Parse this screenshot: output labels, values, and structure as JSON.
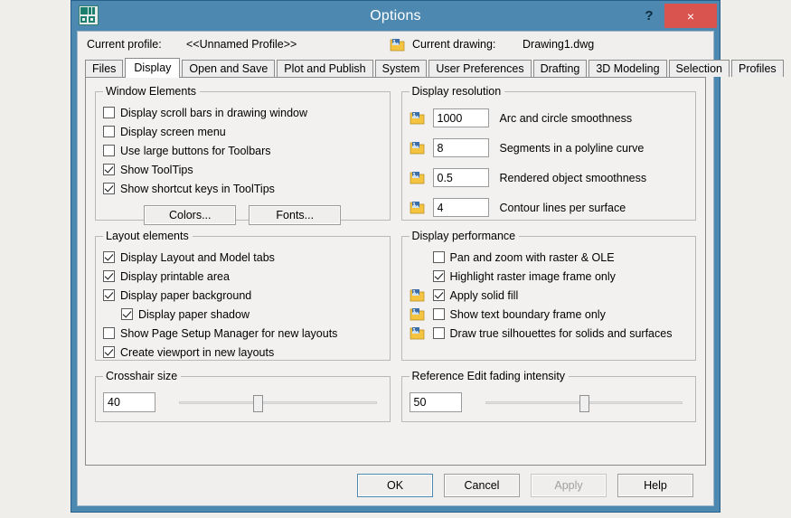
{
  "window": {
    "title": "Options",
    "app_icon": "autocad-icon",
    "help_button": "?",
    "close_button": "×"
  },
  "profile_row": {
    "current_profile_label": "Current profile:",
    "current_profile_value": "<<Unnamed Profile>>",
    "current_drawing_label": "Current drawing:",
    "current_drawing_value": "Drawing1.dwg",
    "drawing_icon": "drawing-file-icon"
  },
  "tabs": [
    {
      "label": "Files",
      "active": false
    },
    {
      "label": "Display",
      "active": true
    },
    {
      "label": "Open and Save",
      "active": false
    },
    {
      "label": "Plot and Publish",
      "active": false
    },
    {
      "label": "System",
      "active": false
    },
    {
      "label": "User Preferences",
      "active": false
    },
    {
      "label": "Drafting",
      "active": false
    },
    {
      "label": "3D Modeling",
      "active": false
    },
    {
      "label": "Selection",
      "active": false
    },
    {
      "label": "Profiles",
      "active": false
    }
  ],
  "window_elements": {
    "legend": "Window Elements",
    "checkboxes": [
      {
        "label": "Display scroll bars in drawing window",
        "checked": false
      },
      {
        "label": "Display screen menu",
        "checked": false
      },
      {
        "label": "Use large buttons for Toolbars",
        "checked": false
      },
      {
        "label": "Show ToolTips",
        "checked": true
      },
      {
        "label": "Show shortcut keys in ToolTips",
        "checked": true
      }
    ],
    "colors_button": "Colors...",
    "fonts_button": "Fonts..."
  },
  "display_resolution": {
    "legend": "Display resolution",
    "rows": [
      {
        "value": "1000",
        "label": "Arc and circle smoothness"
      },
      {
        "value": "8",
        "label": "Segments in a polyline curve"
      },
      {
        "value": "0.5",
        "label": "Rendered object smoothness"
      },
      {
        "value": "4",
        "label": "Contour lines per surface"
      }
    ]
  },
  "layout_elements": {
    "legend": "Layout elements",
    "checkboxes": [
      {
        "label": "Display Layout and Model tabs",
        "checked": true,
        "indent": 0
      },
      {
        "label": "Display printable area",
        "checked": true,
        "indent": 0
      },
      {
        "label": "Display paper background",
        "checked": true,
        "indent": 0
      },
      {
        "label": "Display paper shadow",
        "checked": true,
        "indent": 1
      },
      {
        "label": "Show Page Setup Manager for new layouts",
        "checked": false,
        "indent": 0
      },
      {
        "label": "Create viewport in new layouts",
        "checked": true,
        "indent": 0
      }
    ]
  },
  "display_performance": {
    "legend": "Display performance",
    "checkboxes": [
      {
        "label": "Pan and zoom with raster & OLE",
        "checked": false,
        "icon": false
      },
      {
        "label": "Highlight raster image frame only",
        "checked": true,
        "icon": false
      },
      {
        "label": "Apply solid fill",
        "checked": true,
        "icon": true
      },
      {
        "label": "Show text boundary frame only",
        "checked": false,
        "icon": true
      },
      {
        "label": "Draw true silhouettes for solids and surfaces",
        "checked": false,
        "icon": true
      }
    ]
  },
  "crosshair_size": {
    "legend": "Crosshair size",
    "value": "40",
    "slider_percent": 40
  },
  "reference_edit_fading": {
    "legend": "Reference Edit fading intensity",
    "value": "50",
    "slider_percent": 50
  },
  "footer": {
    "ok": "OK",
    "cancel": "Cancel",
    "apply": "Apply",
    "help": "Help",
    "apply_disabled": true
  },
  "colors": {
    "titlebar": "#4d88b0",
    "close_button": "#d9534f",
    "client_background": "#f0efed",
    "page_background": "#f0eeeb",
    "accent_icon_yellow": "#f4c340",
    "accent_icon_blue": "#3d6ea8"
  }
}
